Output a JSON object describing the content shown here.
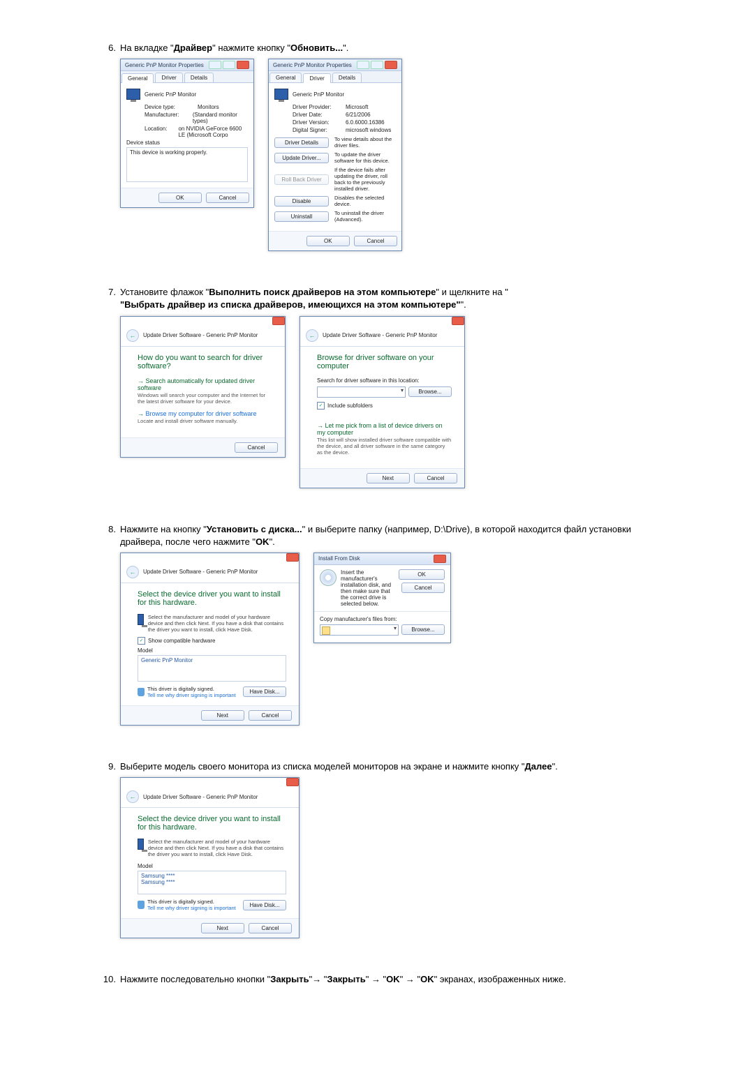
{
  "steps": {
    "s6": {
      "num": "6.",
      "text_pre": "На вкладке \"",
      "bold1": "Драйвер",
      "mid1": "\" нажмите кнопку \"",
      "bold2": "Обновить...",
      "text_post": "\"."
    },
    "s7": {
      "num": "7.",
      "text_pre": "Установите флажок \"",
      "bold1": "Выполнить поиск драйверов на этом компьютере",
      "mid1": "\" и щелкните на \"",
      "bold2": "Выбрать драйвер из списка драйверов, имеющихся на этом компьютере",
      "text_post": "\"."
    },
    "s8": {
      "num": "8.",
      "text_pre": "Нажмите на кнопку \"",
      "bold1": "Установить с диска...",
      "mid1": "\" и выберите папку (например, D:\\Drive), в которой находится файл установки драйвера, после чего нажмите \"",
      "bold2": "OK",
      "text_post": "\"."
    },
    "s9": {
      "num": "9.",
      "text_pre": "Выберите модель своего монитора из списка моделей мониторов на экране и нажмите кнопку \"",
      "bold1": "Далее",
      "text_post": "\"."
    },
    "s10": {
      "num": "10.",
      "text_pre": "Нажмите последовательно кнопки \"",
      "bold1": "Закрыть",
      "mid1": "\"→ \"",
      "bold2": "Закрыть",
      "mid2": "\" → \"",
      "bold3": "OK",
      "mid3": "\" → \"",
      "bold4": "OK",
      "text_post": "\" экранах, изображенных ниже."
    }
  },
  "dlg_props_title": "Generic PnP Monitor Properties",
  "tabs": {
    "general": "General",
    "driver": "Driver",
    "details": "Details"
  },
  "gen": {
    "header": "Generic PnP Monitor",
    "dev_type_l": "Device type:",
    "dev_type_v": "Monitors",
    "manu_l": "Manufacturer:",
    "manu_v": "(Standard monitor types)",
    "loc_l": "Location:",
    "loc_v": "on NVIDIA GeForce 6600 LE (Microsoft Corpo",
    "status_l": "Device status",
    "status_v": "This device is working properly."
  },
  "drv": {
    "prov_l": "Driver Provider:",
    "prov_v": "Microsoft",
    "date_l": "Driver Date:",
    "date_v": "6/21/2006",
    "ver_l": "Driver Version:",
    "ver_v": "6.0.6000.16386",
    "sign_l": "Digital Signer:",
    "sign_v": "microsoft windows",
    "btn_details": "Driver Details",
    "desc_details": "To view details about the driver files.",
    "btn_update": "Update Driver...",
    "desc_update": "To update the driver software for this device.",
    "btn_rollback": "Roll Back Driver",
    "desc_rollback": "If the device fails after updating the driver, roll back to the previously installed driver.",
    "btn_disable": "Disable",
    "desc_disable": "Disables the selected device.",
    "btn_uninstall": "Uninstall",
    "desc_uninstall": "To uninstall the driver (Advanced)."
  },
  "common": {
    "ok": "OK",
    "cancel": "Cancel",
    "next": "Next",
    "browse": "Browse..."
  },
  "wiz_title": "Update Driver Software - Generic PnP Monitor",
  "wiz7a": {
    "h1": "How do you want to search for driver software?",
    "opt1_t": "Search automatically for updated driver software",
    "opt1_s": "Windows will search your computer and the Internet for the latest driver software for your device.",
    "opt2_t": "Browse my computer for driver software",
    "opt2_s": "Locate and install driver software manually."
  },
  "wiz7b": {
    "h1": "Browse for driver software on your computer",
    "search_l": "Search for driver software in this location:",
    "include": "Include subfolders",
    "pick_t": "Let me pick from a list of device drivers on my computer",
    "pick_s": "This list will show installed driver software compatible with the device, and all driver software in the same category as the device."
  },
  "wiz8a": {
    "h1": "Select the device driver you want to install for this hardware.",
    "sub": "Select the manufacturer and model of your hardware device and then click Next. If you have a disk that contains the driver you want to install, click Have Disk.",
    "compat": "Show compatible hardware",
    "model_l": "Model",
    "model_item": "Generic PnP Monitor",
    "signed": "This driver is digitally signed.",
    "tell": "Tell me why driver signing is important",
    "have_disk": "Have Disk..."
  },
  "idisk": {
    "title": "Install From Disk",
    "msg": "Insert the manufacturer's installation disk, and then make sure that the correct drive is selected below.",
    "copy_l": "Copy manufacturer's files from:"
  },
  "wiz9": {
    "model1": "Samsung ****",
    "model2": "Samsung ****"
  }
}
